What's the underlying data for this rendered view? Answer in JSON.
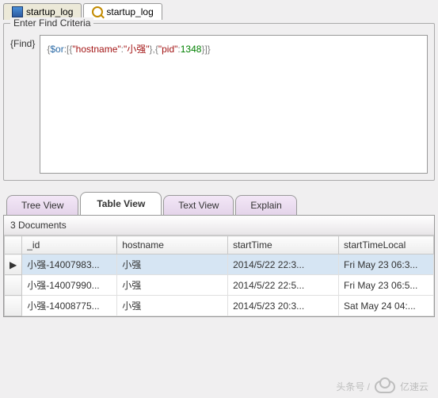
{
  "topTabs": [
    {
      "label": "startup_log",
      "icon": "doc"
    },
    {
      "label": "startup_log",
      "icon": "mag"
    }
  ],
  "find": {
    "legend": "Enter Find Criteria",
    "label": "{Find}",
    "query": {
      "raw": "{$or:[{\"hostname\":\"小强\"},{\"pid\":1348}]}",
      "tokens": [
        {
          "t": "{",
          "c": "punc"
        },
        {
          "t": "$or",
          "c": "op"
        },
        {
          "t": ":[{",
          "c": "punc"
        },
        {
          "t": "\"hostname\"",
          "c": "key"
        },
        {
          "t": ":",
          "c": "punc"
        },
        {
          "t": "\"小强\"",
          "c": "str"
        },
        {
          "t": "},{",
          "c": "punc"
        },
        {
          "t": "\"pid\"",
          "c": "key"
        },
        {
          "t": ":",
          "c": "punc"
        },
        {
          "t": "1348",
          "c": "num"
        },
        {
          "t": "}]}",
          "c": "punc"
        }
      ]
    }
  },
  "viewTabs": [
    "Tree View",
    "Table View",
    "Text View",
    "Explain"
  ],
  "activeViewTab": 1,
  "docsHeader": "3 Documents",
  "columns": [
    "_id",
    "hostname",
    "startTime",
    "startTimeLocal"
  ],
  "rows": [
    {
      "_id": "小强-14007983...",
      "hostname": "小强",
      "startTime": "2014/5/22 22:3...",
      "startTimeLocal": "Fri May 23 06:3..."
    },
    {
      "_id": "小强-14007990...",
      "hostname": "小强",
      "startTime": "2014/5/22 22:5...",
      "startTimeLocal": "Fri May 23 06:5..."
    },
    {
      "_id": "小强-14008775...",
      "hostname": "小强",
      "startTime": "2014/5/23 20:3...",
      "startTimeLocal": "Sat May 24 04:..."
    }
  ],
  "selectedRow": 0,
  "rowMarker": "▶",
  "watermark": {
    "text1": "头条号 /",
    "text2": "亿速云"
  }
}
